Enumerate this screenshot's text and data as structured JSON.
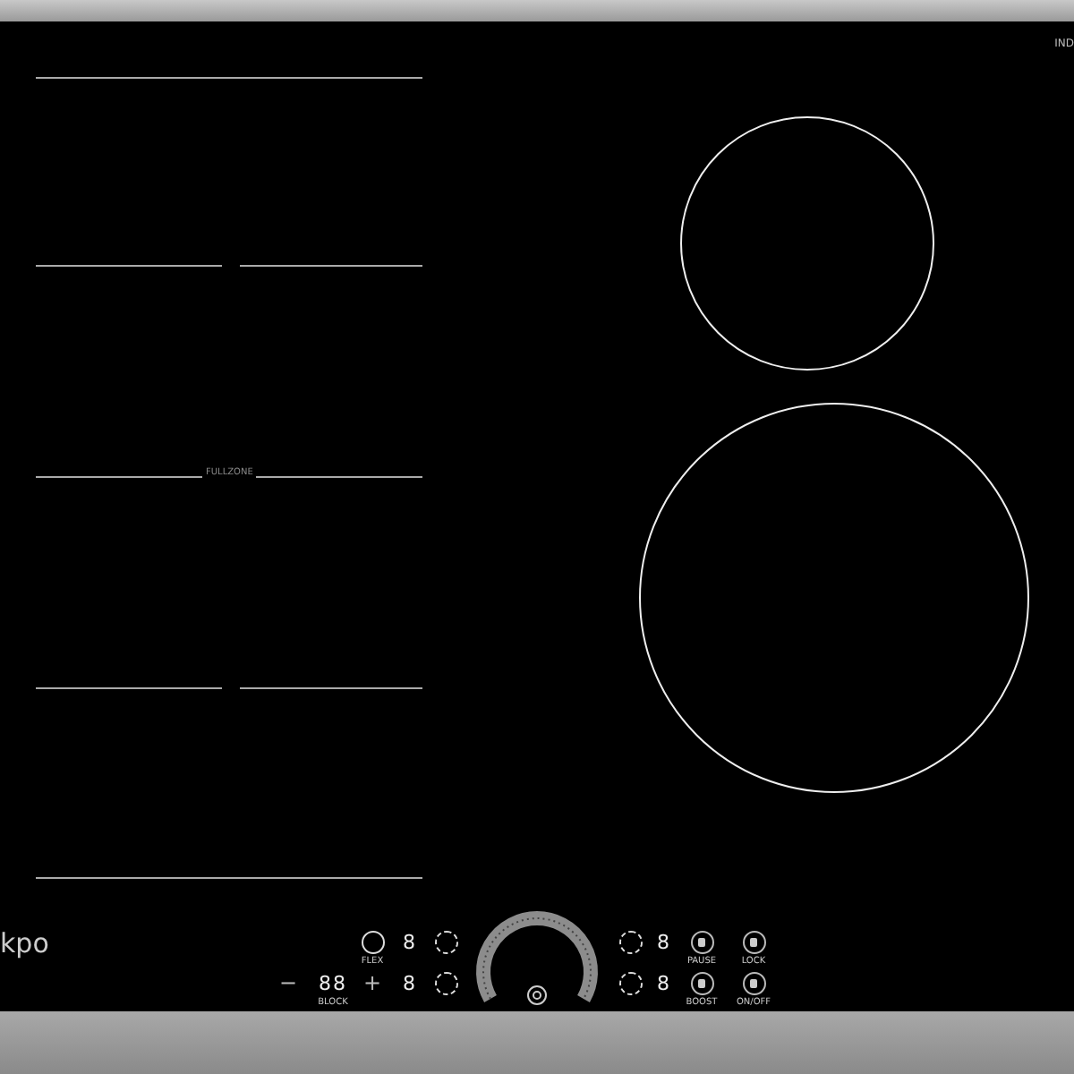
{
  "brand": "kpo",
  "badge": "IND",
  "zone_label": "FULLZONE",
  "rows": [
    [
      {
        "kind": "sensor",
        "label": "FLEX"
      },
      {
        "kind": "digit",
        "text": "8"
      },
      {
        "kind": "dashed"
      },
      {
        "kind": "dial"
      },
      {
        "kind": "dashed"
      },
      {
        "kind": "digit",
        "text": "8"
      },
      {
        "kind": "button",
        "label": "PAUSE"
      },
      {
        "kind": "button",
        "label": "LOCK"
      }
    ],
    [
      {
        "kind": "minus",
        "text": "−"
      },
      {
        "kind": "digit",
        "text": "88",
        "label": "BLOCK"
      },
      {
        "kind": "plus",
        "text": "+"
      },
      {
        "kind": "digit",
        "text": "8"
      },
      {
        "kind": "dashed"
      },
      {
        "kind": "dial"
      },
      {
        "kind": "dashed"
      },
      {
        "kind": "digit",
        "text": "8"
      },
      {
        "kind": "button",
        "label": "BOOST"
      },
      {
        "kind": "button",
        "label": "ON/OFF"
      }
    ]
  ]
}
